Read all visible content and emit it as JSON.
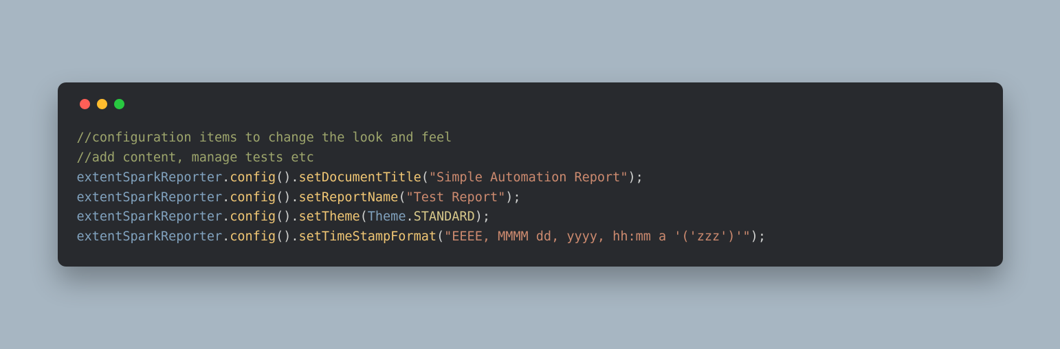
{
  "window": {
    "dots": [
      "red",
      "yellow",
      "green"
    ]
  },
  "code": {
    "comment1": "//configuration items to change the look and feel",
    "comment2": "//add content, manage tests etc",
    "ident": "extentSparkReporter",
    "dot": ".",
    "config": "config",
    "parens": "()",
    "setDocTitle": "setDocumentTitle",
    "open": "(",
    "close": ")",
    "semi": ";",
    "str_doc_title": "\"Simple Automation Report\"",
    "setRepName": "setReportName",
    "str_rep_name": "\"Test Report\"",
    "setTheme": "setTheme",
    "theme_class": "Theme",
    "theme_val": "STANDARD",
    "setTS": "setTimeStampFormat",
    "str_ts": "\"EEEE, MMMM dd, yyyy, hh:mm a '('zzz')'\""
  }
}
